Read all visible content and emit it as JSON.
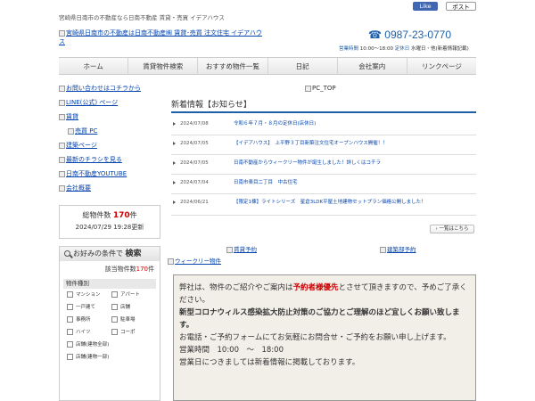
{
  "header": {
    "tagline": "宮崎県日南市の不動産なら日南不動産 賃貸・売買 イデアハウス",
    "logo_alt": "宮崎県日南市の不動産は日南不動産㈱ 賃貸･売買 注文住宅 イデアハウス",
    "phone": "0987-23-0770",
    "hours_label": "営業時間",
    "hours_value": "10:00～18:00",
    "holiday_label": "定休日",
    "holiday_value": "水曜日・他(新着情報記載)",
    "facebook_like": "Like",
    "x_post": "ポスト"
  },
  "nav": {
    "items": [
      "ホーム",
      "賃貸物件検索",
      "おすすめ物件一覧",
      "日記",
      "会社案内",
      "リンクページ"
    ]
  },
  "sidebar": {
    "links": [
      "お問い合わせはコチラから",
      "LINE(公式) ページ",
      "賃貸",
      "売買 PC",
      "建築ページ",
      "最新のチラシを見る",
      "日南不動産YOUTUBE",
      "会社概要"
    ],
    "count_label": "総物件数",
    "count_value": "170",
    "count_unit": "件",
    "updated": "2024/07/29 19:28更新"
  },
  "search": {
    "heading_prefix": "お好みの条件で",
    "heading_bold": "検索",
    "hits_label": "該当物件数",
    "hits_value": "170",
    "hits_unit": "件",
    "category_title": "物件種別",
    "options": [
      "マンション",
      "アパート",
      "一戸建て",
      "店舗",
      "事務所",
      "駐車場",
      "ハイツ",
      "コーポ",
      "店舗(建物全部)",
      "店舗(建物一部)"
    ]
  },
  "main": {
    "pc_top_alt": "PC_TOP",
    "news_title": "新着情報【お知らせ】",
    "news": [
      {
        "date": "2024/07/08",
        "title": "令和６年７月・８月の定休日(店休日)"
      },
      {
        "date": "2024/07/05",
        "title": "【イデアハウス】　上平野３丁目新築注文住宅オープンハウス開催！！"
      },
      {
        "date": "2024/07/05",
        "title": "日南不動産からウィークリー物件が誕生しました！詳しくはコチラ"
      },
      {
        "date": "2024/07/04",
        "title": "日南市楽目二丁目　中古住宅"
      },
      {
        "date": "2024/06/21",
        "title": "【限定1棟】ライトシリーズ　星倉3LDK平屋土地建物セットプラン価格公開しました！"
      }
    ],
    "more_button": "一覧はこちら",
    "banners": {
      "rental": "賃貸予約",
      "construction": "建築部予約",
      "weekly": "ウィークリー物件"
    },
    "notice": {
      "line1_a": "弊社は、物件のご紹介やご案内は",
      "line1_red": "予約者様優先",
      "line1_b": "とさせて頂きますので、予めご了承ください。",
      "line2": "新型コロナウィルス感染拡大防止対策のご協力とご理解のほど宜しくお願い致します。",
      "line3": "お電話・ご予約フォームにてお気軽にお問合せ・ご予約をお願い申し上げます。",
      "line4": "営業時間　10:00　～　18:00",
      "line5": "営業日につきましては新着情報に掲載しております。"
    }
  }
}
